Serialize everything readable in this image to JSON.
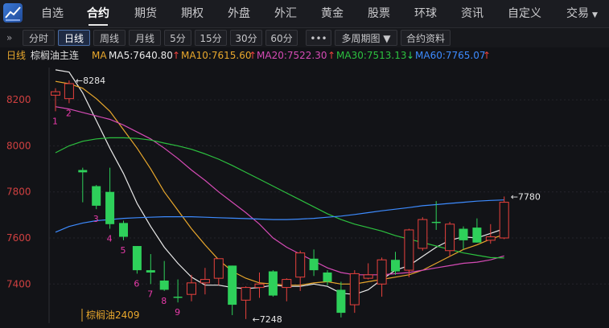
{
  "nav": {
    "tabs": [
      {
        "label": "自选",
        "active": false
      },
      {
        "label": "合约",
        "active": true
      },
      {
        "label": "期货",
        "active": false
      },
      {
        "label": "期权",
        "active": false
      },
      {
        "label": "外盘",
        "active": false
      },
      {
        "label": "外汇",
        "active": false
      },
      {
        "label": "黄金",
        "active": false
      },
      {
        "label": "股票",
        "active": false
      },
      {
        "label": "环球",
        "active": false
      },
      {
        "label": "资讯",
        "active": false
      },
      {
        "label": "自定义",
        "active": false
      },
      {
        "label": "交易",
        "active": false
      }
    ],
    "trade_caret": "▼"
  },
  "toolbar": {
    "collapse_icon": "»",
    "buttons": [
      {
        "label": "分时",
        "active": false
      },
      {
        "label": "日线",
        "active": true
      },
      {
        "label": "周线",
        "active": false
      },
      {
        "label": "月线",
        "active": false
      },
      {
        "label": "5分",
        "active": false
      },
      {
        "label": "15分",
        "active": false
      },
      {
        "label": "30分",
        "active": false
      },
      {
        "label": "60分",
        "active": false
      },
      {
        "label": "•••",
        "active": false
      },
      {
        "label": "多周期图 ▼",
        "active": false
      },
      {
        "label": "合约资料",
        "active": false
      }
    ]
  },
  "info": {
    "period": "日线",
    "contract": "棕榈油主连",
    "ma_label": "MA",
    "ma5": "MA5:7640.80",
    "ma10": "MA10:7615.60",
    "ma20": "MA20:7522.30",
    "ma30": "MA30:7513.13",
    "ma60": "MA60:7765.07",
    "ma5_arrow": "↑",
    "ma10_arrow": "↑",
    "ma20_arrow": "↑",
    "ma30_arrow": "↓",
    "ma60_arrow": "↑"
  },
  "colors": {
    "up": "#e8413d",
    "down": "#2ed05a",
    "ma5": "#e9e9e9",
    "ma10": "#e8a72c",
    "ma20": "#d54bb5",
    "ma30": "#2cc03f",
    "ma60": "#3d8bff",
    "period": "#e8a72c",
    "wave": "#e83aa9"
  },
  "chart_data": {
    "type": "candlestick",
    "ylim": [
      7230,
      8340
    ],
    "y_ticks": [
      8200,
      8000,
      7800,
      7600,
      7400
    ],
    "high_marker": {
      "value": 8284,
      "label": "8284"
    },
    "low_marker": {
      "value": 7248,
      "label": "7248"
    },
    "last_marker": {
      "value": 7780,
      "label": "7780"
    },
    "contract_label": "棕榈油2409",
    "candles": [
      {
        "o": 8220,
        "h": 8250,
        "l": 8150,
        "c": 8235
      },
      {
        "o": 8205,
        "h": 8284,
        "l": 8185,
        "c": 8270
      },
      {
        "o": 7895,
        "h": 7905,
        "l": 7755,
        "c": 7885
      },
      {
        "o": 7825,
        "h": 7830,
        "l": 7725,
        "c": 7740
      },
      {
        "o": 7800,
        "h": 7905,
        "l": 7640,
        "c": 7660
      },
      {
        "o": 7665,
        "h": 7675,
        "l": 7590,
        "c": 7605
      },
      {
        "o": 7565,
        "h": 7565,
        "l": 7445,
        "c": 7460
      },
      {
        "o": 7460,
        "h": 7530,
        "l": 7400,
        "c": 7450
      },
      {
        "o": 7415,
        "h": 7500,
        "l": 7370,
        "c": 7375
      },
      {
        "o": 7345,
        "h": 7420,
        "l": 7320,
        "c": 7340
      },
      {
        "o": 7355,
        "h": 7440,
        "l": 7325,
        "c": 7405
      },
      {
        "o": 7405,
        "h": 7470,
        "l": 7355,
        "c": 7420
      },
      {
        "o": 7425,
        "h": 7510,
        "l": 7395,
        "c": 7510
      },
      {
        "o": 7480,
        "h": 7480,
        "l": 7265,
        "c": 7310
      },
      {
        "o": 7330,
        "h": 7390,
        "l": 7248,
        "c": 7385
      },
      {
        "o": 7385,
        "h": 7450,
        "l": 7340,
        "c": 7400
      },
      {
        "o": 7455,
        "h": 7460,
        "l": 7345,
        "c": 7350
      },
      {
        "o": 7385,
        "h": 7425,
        "l": 7325,
        "c": 7420
      },
      {
        "o": 7430,
        "h": 7545,
        "l": 7370,
        "c": 7535
      },
      {
        "o": 7510,
        "h": 7550,
        "l": 7435,
        "c": 7460
      },
      {
        "o": 7450,
        "h": 7460,
        "l": 7395,
        "c": 7410
      },
      {
        "o": 7375,
        "h": 7410,
        "l": 7255,
        "c": 7275
      },
      {
        "o": 7310,
        "h": 7460,
        "l": 7275,
        "c": 7445
      },
      {
        "o": 7425,
        "h": 7490,
        "l": 7420,
        "c": 7440
      },
      {
        "o": 7400,
        "h": 7515,
        "l": 7345,
        "c": 7505
      },
      {
        "o": 7505,
        "h": 7540,
        "l": 7440,
        "c": 7455
      },
      {
        "o": 7460,
        "h": 7640,
        "l": 7430,
        "c": 7635
      },
      {
        "o": 7555,
        "h": 7690,
        "l": 7545,
        "c": 7680
      },
      {
        "o": 7670,
        "h": 7760,
        "l": 7635,
        "c": 7665
      },
      {
        "o": 7545,
        "h": 7670,
        "l": 7520,
        "c": 7660
      },
      {
        "o": 7640,
        "h": 7650,
        "l": 7550,
        "c": 7590
      },
      {
        "o": 7645,
        "h": 7685,
        "l": 7580,
        "c": 7580
      },
      {
        "o": 7590,
        "h": 7660,
        "l": 7575,
        "c": 7605
      },
      {
        "o": 7600,
        "h": 7780,
        "l": 7595,
        "c": 7755
      }
    ],
    "wave_labels": [
      {
        "index": 0,
        "label": "1"
      },
      {
        "index": 1,
        "label": "2"
      },
      {
        "index": 3,
        "label": "3"
      },
      {
        "index": 4,
        "label": "4"
      },
      {
        "index": 5,
        "label": "5"
      },
      {
        "index": 6,
        "label": "6"
      },
      {
        "index": 7,
        "label": "7"
      },
      {
        "index": 8,
        "label": "8"
      },
      {
        "index": 9,
        "label": "9"
      }
    ],
    "series": [
      {
        "name": "MA5",
        "values": [
          8330,
          8320,
          8230,
          8110,
          7990,
          7880,
          7750,
          7650,
          7560,
          7490,
          7430,
          7395,
          7395,
          7385,
          7380,
          7385,
          7395,
          7390,
          7390,
          7400,
          7390,
          7360,
          7355,
          7375,
          7420,
          7460,
          7480,
          7520,
          7560,
          7590,
          7605,
          7600,
          7620,
          7640
        ]
      },
      {
        "name": "MA10",
        "values": [
          8280,
          8270,
          8250,
          8205,
          8150,
          8070,
          7990,
          7900,
          7800,
          7720,
          7640,
          7570,
          7505,
          7455,
          7425,
          7405,
          7400,
          7395,
          7395,
          7405,
          7410,
          7400,
          7400,
          7410,
          7420,
          7430,
          7440,
          7460,
          7490,
          7520,
          7550,
          7570,
          7595,
          7615
        ]
      },
      {
        "name": "MA20",
        "values": [
          8170,
          8160,
          8145,
          8130,
          8115,
          8090,
          8060,
          8030,
          7990,
          7945,
          7895,
          7850,
          7800,
          7755,
          7710,
          7660,
          7600,
          7560,
          7530,
          7500,
          7470,
          7450,
          7440,
          7440,
          7440,
          7445,
          7450,
          7460,
          7470,
          7480,
          7490,
          7495,
          7505,
          7522
        ]
      },
      {
        "name": "MA30",
        "values": [
          7970,
          8000,
          8020,
          8030,
          8035,
          8035,
          8032,
          8025,
          8012,
          8000,
          7985,
          7965,
          7942,
          7915,
          7885,
          7855,
          7825,
          7795,
          7765,
          7735,
          7705,
          7680,
          7660,
          7645,
          7630,
          7610,
          7595,
          7580,
          7565,
          7550,
          7535,
          7525,
          7515,
          7513
        ]
      },
      {
        "name": "MA60",
        "values": [
          7625,
          7650,
          7665,
          7675,
          7680,
          7685,
          7688,
          7690,
          7692,
          7692,
          7692,
          7690,
          7688,
          7686,
          7684,
          7682,
          7680,
          7680,
          7682,
          7685,
          7690,
          7695,
          7702,
          7710,
          7718,
          7725,
          7732,
          7740,
          7745,
          7750,
          7755,
          7760,
          7763,
          7765
        ]
      }
    ]
  }
}
